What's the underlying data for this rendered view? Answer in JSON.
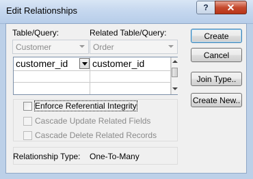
{
  "window": {
    "title": "Edit Relationships",
    "help_label": "?",
    "close_label": "✕"
  },
  "labels": {
    "table_query": "Table/Query:",
    "related_table_query": "Related Table/Query:"
  },
  "table_combo": {
    "value": "Customer"
  },
  "related_combo": {
    "value": "Order"
  },
  "grid": {
    "rows": [
      {
        "left": "customer_id",
        "right": "customer_id"
      },
      {
        "left": "",
        "right": ""
      },
      {
        "left": "",
        "right": ""
      }
    ]
  },
  "options": {
    "enforce": "Enforce Referential Integrity",
    "cascade_update": "Cascade Update Related Fields",
    "cascade_delete": "Cascade Delete Related Records"
  },
  "relationship": {
    "label": "Relationship Type:",
    "value": "One-To-Many"
  },
  "buttons": {
    "create": "Create",
    "cancel": "Cancel",
    "join_type": "Join Type..",
    "create_new": "Create New.."
  },
  "icons": {
    "combo_arrow": "chevron-down-icon",
    "scroll_up": "scroll-up-icon",
    "scroll_down": "scroll-down-icon"
  }
}
